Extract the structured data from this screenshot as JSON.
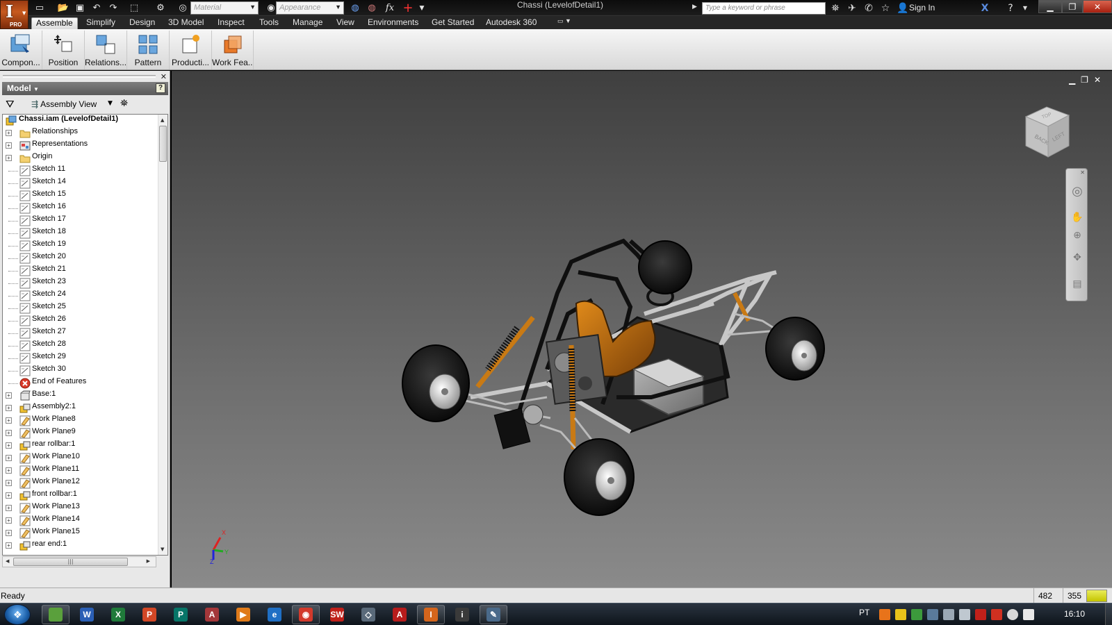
{
  "window": {
    "title": "Chassi (LevelofDetail1)",
    "app_badge": "PRO",
    "app_letter": "I"
  },
  "quick_access": {
    "material_placeholder": "Material",
    "appearance_placeholder": "Appearance",
    "fx_label": "fx"
  },
  "help_bar": {
    "search_placeholder": "Type a keyword or phrase",
    "sign_in": "Sign In"
  },
  "menu": {
    "items": [
      "Assemble",
      "Simplify",
      "Design",
      "3D Model",
      "Inspect",
      "Tools",
      "Manage",
      "View",
      "Environments",
      "Get Started",
      "Autodesk 360"
    ],
    "active": "Assemble"
  },
  "ribbon": {
    "buttons": [
      {
        "label": "Compon...",
        "icon": "place-component-icon"
      },
      {
        "label": "Position",
        "icon": "free-move-icon"
      },
      {
        "label": "Relations...",
        "icon": "constrain-icon"
      },
      {
        "label": "Pattern",
        "icon": "pattern-icon"
      },
      {
        "label": "Producti...",
        "icon": "productivity-icon"
      },
      {
        "label": "Work Fea...",
        "icon": "work-features-icon"
      }
    ]
  },
  "browser": {
    "title": "Model",
    "view": "Assembly View",
    "help": "?",
    "tree": [
      {
        "label": "Chassi.iam (LevelofDetail1)",
        "icon": "assembly",
        "root": true
      },
      {
        "label": "Relationships",
        "icon": "folder",
        "expand": true
      },
      {
        "label": "Representations",
        "icon": "representations",
        "expand": true
      },
      {
        "label": "Origin",
        "icon": "folder",
        "expand": true
      },
      {
        "label": "Sketch 11",
        "icon": "sketch"
      },
      {
        "label": "Sketch 14",
        "icon": "sketch"
      },
      {
        "label": "Sketch 15",
        "icon": "sketch"
      },
      {
        "label": "Sketch 16",
        "icon": "sketch"
      },
      {
        "label": "Sketch 17",
        "icon": "sketch"
      },
      {
        "label": "Sketch 18",
        "icon": "sketch"
      },
      {
        "label": "Sketch 19",
        "icon": "sketch"
      },
      {
        "label": "Sketch 20",
        "icon": "sketch"
      },
      {
        "label": "Sketch 21",
        "icon": "sketch"
      },
      {
        "label": "Sketch 23",
        "icon": "sketch"
      },
      {
        "label": "Sketch 24",
        "icon": "sketch"
      },
      {
        "label": "Sketch 25",
        "icon": "sketch"
      },
      {
        "label": "Sketch 26",
        "icon": "sketch"
      },
      {
        "label": "Sketch 27",
        "icon": "sketch"
      },
      {
        "label": "Sketch 28",
        "icon": "sketch"
      },
      {
        "label": "Sketch 29",
        "icon": "sketch"
      },
      {
        "label": "Sketch 30",
        "icon": "sketch"
      },
      {
        "label": "End of Features",
        "icon": "end"
      },
      {
        "label": "Base:1",
        "icon": "part",
        "expand": true
      },
      {
        "label": "Assembly2:1",
        "icon": "subassembly",
        "expand": true
      },
      {
        "label": "Work Plane8",
        "icon": "workplane",
        "expand": true
      },
      {
        "label": "Work Plane9",
        "icon": "workplane",
        "expand": true
      },
      {
        "label": "rear rollbar:1",
        "icon": "subassembly",
        "expand": true
      },
      {
        "label": "Work Plane10",
        "icon": "workplane",
        "expand": true
      },
      {
        "label": "Work Plane11",
        "icon": "workplane",
        "expand": true
      },
      {
        "label": "Work Plane12",
        "icon": "workplane",
        "expand": true
      },
      {
        "label": "front rollbar:1",
        "icon": "subassembly",
        "expand": true
      },
      {
        "label": "Work Plane13",
        "icon": "workplane",
        "expand": true
      },
      {
        "label": "Work Plane14",
        "icon": "workplane",
        "expand": true
      },
      {
        "label": "Work Plane15",
        "icon": "workplane",
        "expand": true
      },
      {
        "label": "rear end:1",
        "icon": "subassembly",
        "expand": true
      }
    ]
  },
  "viewcube": {
    "faces": [
      "BACK",
      "LEFT",
      "TOP"
    ]
  },
  "triad": {
    "x": "X",
    "y": "Y",
    "z": "Z"
  },
  "status": {
    "text": "Ready",
    "num1": "482",
    "num2": "355"
  },
  "taskbar": {
    "apps": [
      {
        "name": "explorer",
        "color": "#5aa03c",
        "letter": ""
      },
      {
        "name": "word",
        "color": "#2b5fb5",
        "letter": "W"
      },
      {
        "name": "excel",
        "color": "#1f7a3a",
        "letter": "X"
      },
      {
        "name": "powerpoint",
        "color": "#d24726",
        "letter": "P"
      },
      {
        "name": "publisher",
        "color": "#077568",
        "letter": "P"
      },
      {
        "name": "access",
        "color": "#a4373a",
        "letter": "A"
      },
      {
        "name": "media-player",
        "color": "#e07b1a",
        "letter": "▶"
      },
      {
        "name": "internet-explorer",
        "color": "#1f6fc4",
        "letter": "e"
      },
      {
        "name": "chrome",
        "color": "#d33a2c",
        "letter": "◉"
      },
      {
        "name": "solidworks",
        "color": "#c0201a",
        "letter": "SW"
      },
      {
        "name": "cad-app",
        "color": "#5a6a7a",
        "letter": "◇"
      },
      {
        "name": "acrobat",
        "color": "#b71c1c",
        "letter": "A"
      },
      {
        "name": "inventor",
        "color": "#d4651c",
        "letter": "I"
      },
      {
        "name": "info-app",
        "color": "#3a3a3a",
        "letter": "i"
      },
      {
        "name": "tool-app",
        "color": "#4a6a8a",
        "letter": "✎"
      }
    ],
    "language": "PT",
    "time": "16:10"
  }
}
